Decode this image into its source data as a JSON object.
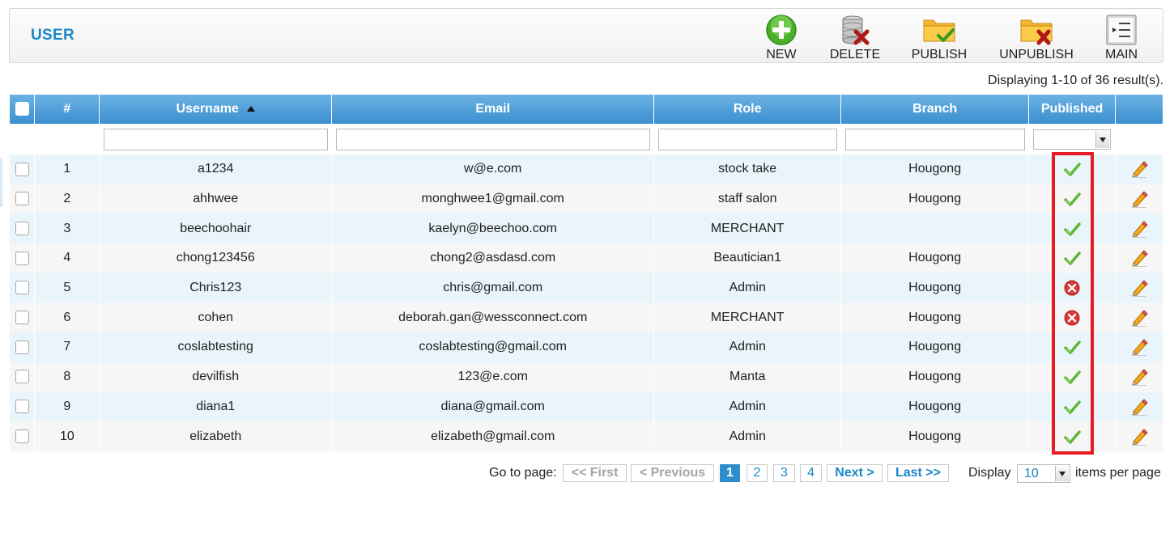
{
  "page": {
    "title": "USER"
  },
  "toolbar": {
    "new_label": "NEW",
    "delete_label": "DELETE",
    "publish_label": "PUBLISH",
    "unpublish_label": "UNPUBLISH",
    "main_label": "MAIN"
  },
  "result_count": "Displaying 1-10 of 36 result(s).",
  "table": {
    "columns": {
      "index": "#",
      "username": "Username",
      "email": "Email",
      "role": "Role",
      "branch": "Branch",
      "published": "Published"
    },
    "sort": {
      "column": "username",
      "direction": "asc"
    },
    "rows": [
      {
        "index": "1",
        "username": "a1234",
        "email": "w@e.com",
        "role": "stock take",
        "branch": "Hougong",
        "published": true
      },
      {
        "index": "2",
        "username": "ahhwee",
        "email": "monghwee1@gmail.com",
        "role": "staff salon",
        "branch": "Hougong",
        "published": true
      },
      {
        "index": "3",
        "username": "beechoohair",
        "email": "kaelyn@beechoo.com",
        "role": "MERCHANT",
        "branch": "",
        "published": true
      },
      {
        "index": "4",
        "username": "chong123456",
        "email": "chong2@asdasd.com",
        "role": "Beautician1",
        "branch": "Hougong",
        "published": true
      },
      {
        "index": "5",
        "username": "Chris123",
        "email": "chris@gmail.com",
        "role": "Admin",
        "branch": "Hougong",
        "published": false
      },
      {
        "index": "6",
        "username": "cohen",
        "email": "deborah.gan@wessconnect.com",
        "role": "MERCHANT",
        "branch": "Hougong",
        "published": false
      },
      {
        "index": "7",
        "username": "coslabtesting",
        "email": "coslabtesting@gmail.com",
        "role": "Admin",
        "branch": "Hougong",
        "published": true
      },
      {
        "index": "8",
        "username": "devilfish",
        "email": "123@e.com",
        "role": "Manta",
        "branch": "Hougong",
        "published": true
      },
      {
        "index": "9",
        "username": "diana1",
        "email": "diana@gmail.com",
        "role": "Admin",
        "branch": "Hougong",
        "published": true
      },
      {
        "index": "10",
        "username": "elizabeth",
        "email": "elizabeth@gmail.com",
        "role": "Admin",
        "branch": "Hougong",
        "published": true
      }
    ]
  },
  "pagination": {
    "goto_label": "Go to page:",
    "first_label": "<< First",
    "prev_label": "< Previous",
    "pages": [
      "1",
      "2",
      "3",
      "4"
    ],
    "current_page": "1",
    "next_label": "Next >",
    "last_label": "Last >>",
    "display_label": "Display",
    "per_page": "10",
    "items_label": "items per page"
  },
  "colors": {
    "accent": "#1b87c9",
    "header_blue": "#3a8fd0",
    "highlight": "#e51c23",
    "published_green": "#5fb536",
    "unpublished_red": "#d83a3a"
  },
  "icons": {
    "new": "plus-circle-icon",
    "delete": "database-delete-icon",
    "publish": "folder-check-icon",
    "unpublish": "folder-x-icon",
    "main": "document-list-icon",
    "published": "checkmark-icon",
    "unpublished": "x-circle-icon",
    "edit": "pencil-icon"
  }
}
